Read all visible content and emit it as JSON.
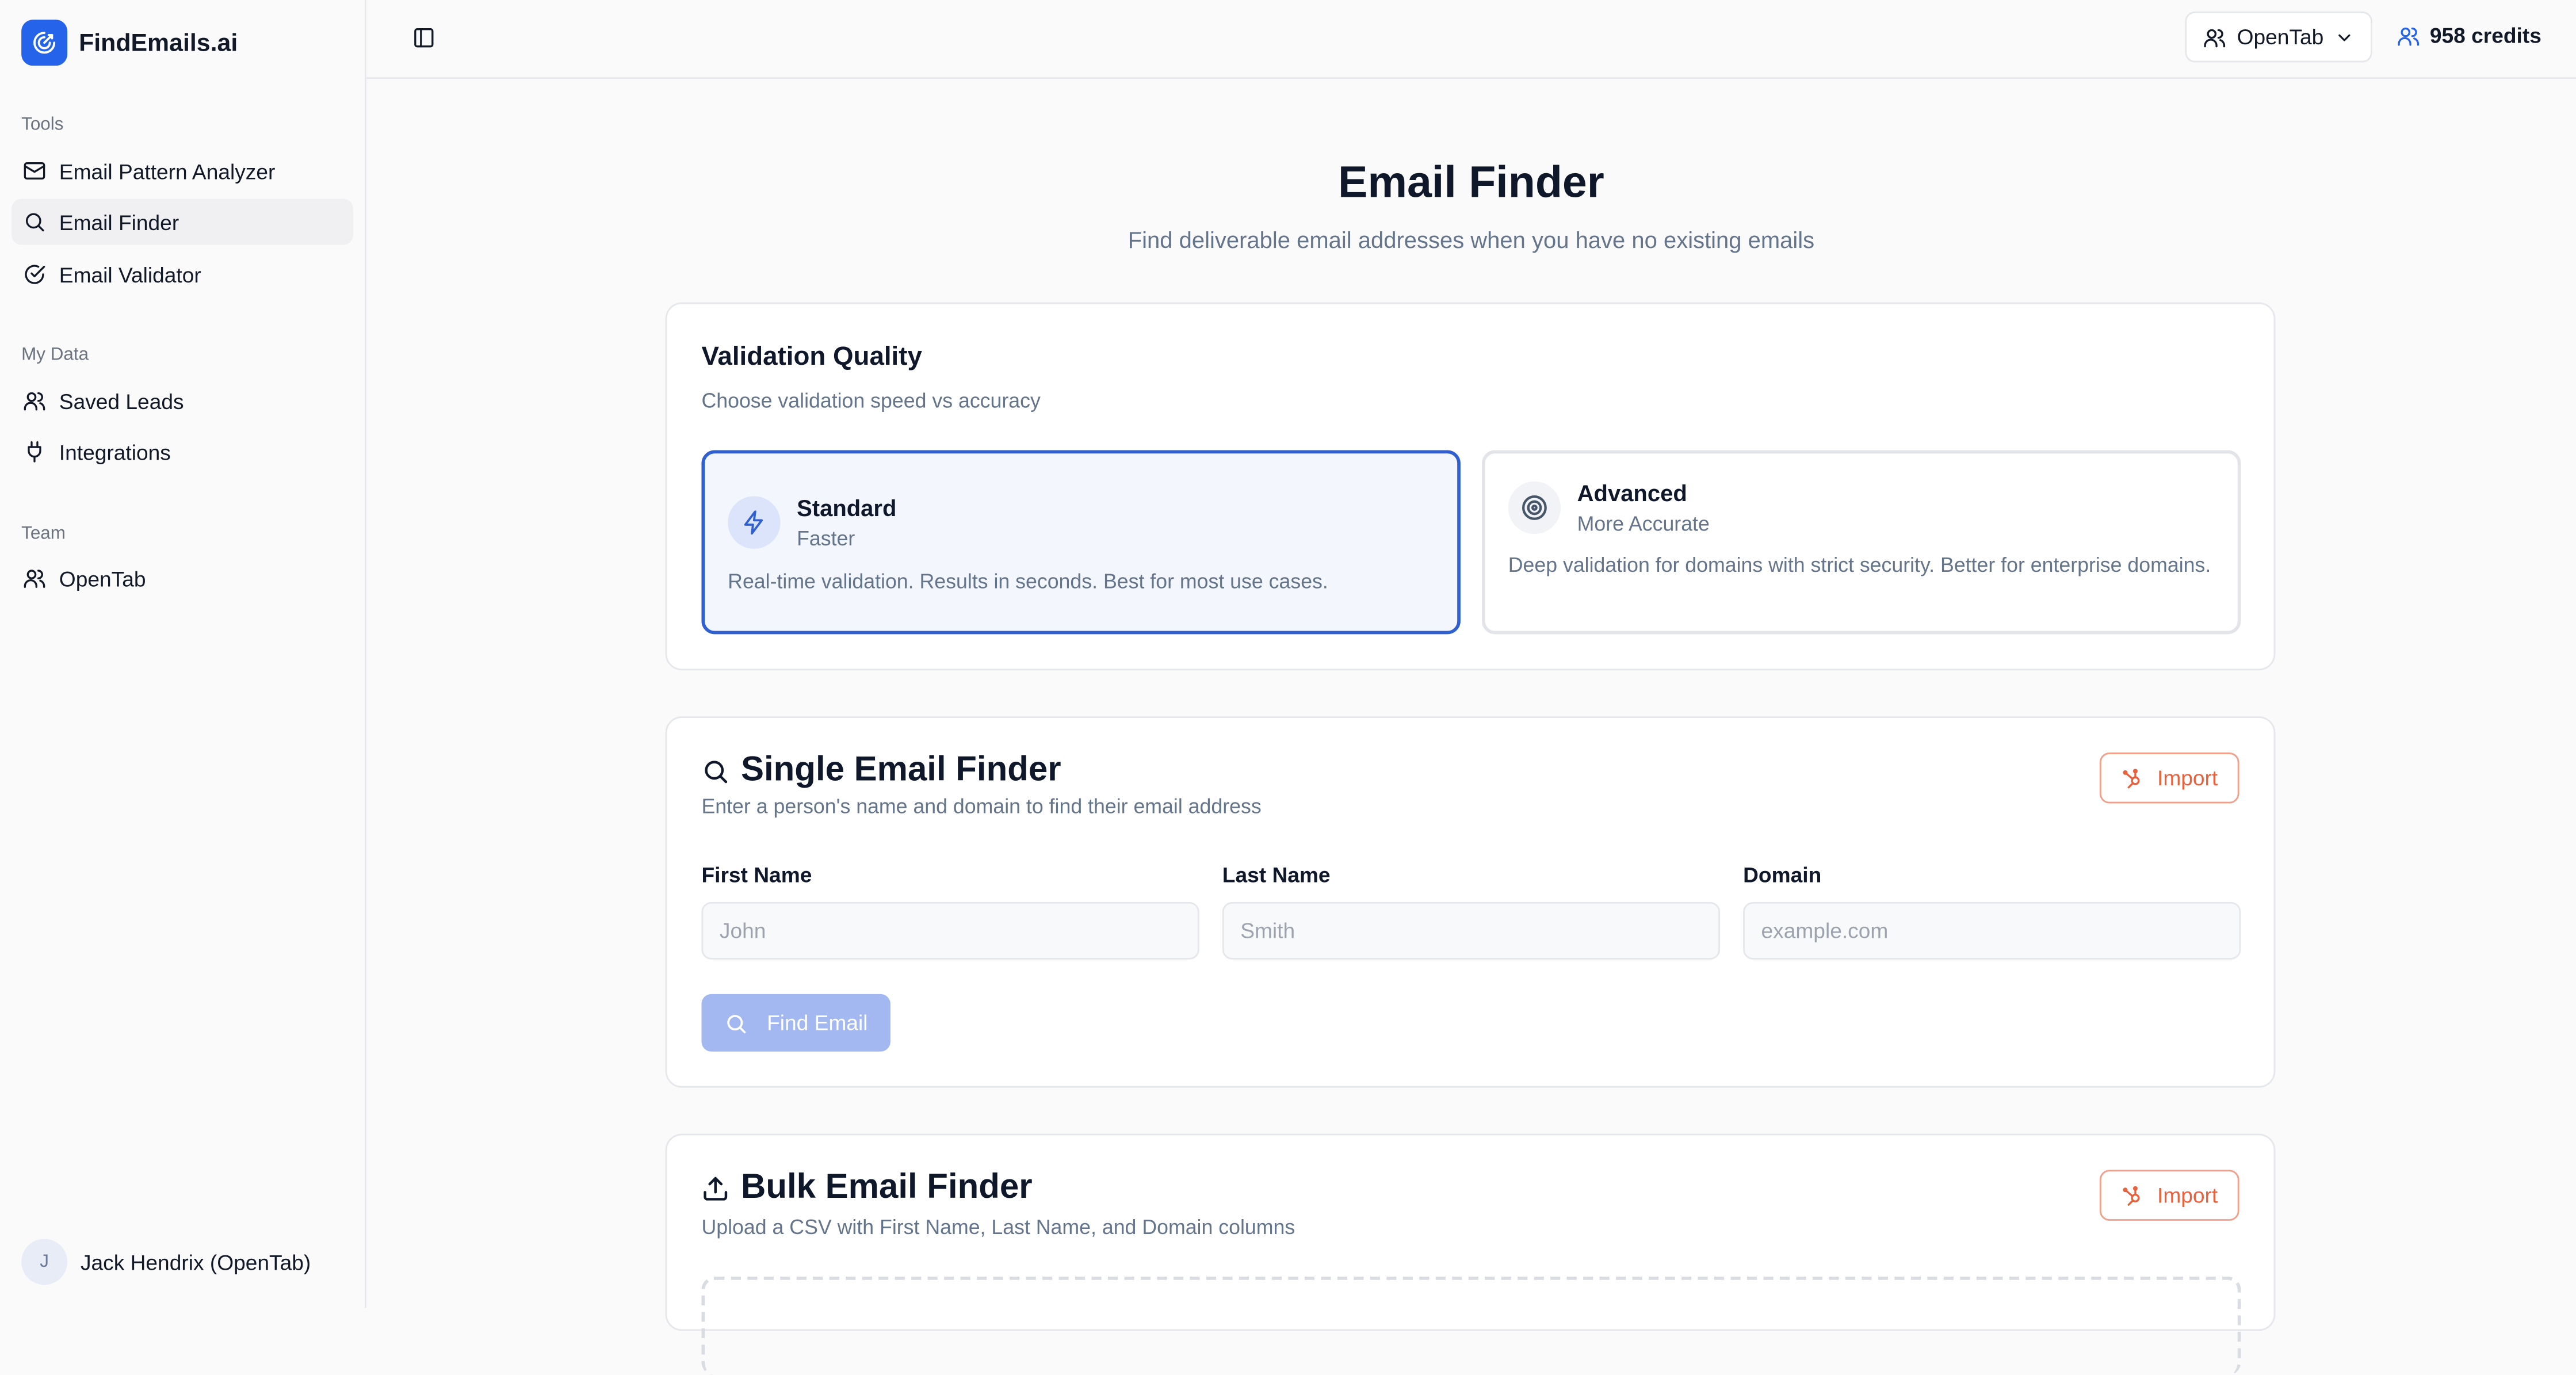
{
  "brand": {
    "name": "FindEmails.ai"
  },
  "sidebar": {
    "sections": [
      {
        "label": "Tools",
        "items": [
          "Email Pattern Analyzer",
          "Email Finder",
          "Email Validator"
        ]
      },
      {
        "label": "My Data",
        "items": [
          "Saved Leads",
          "Integrations"
        ]
      },
      {
        "label": "Team",
        "items": [
          "OpenTab"
        ]
      }
    ],
    "active_item": "Email Finder",
    "user": {
      "initial": "J",
      "name": "Jack Hendrix (OpenTab)"
    }
  },
  "topbar": {
    "team": "OpenTab",
    "credits": "958 credits"
  },
  "page": {
    "title": "Email Finder",
    "subtitle": "Find deliverable email addresses when you have no existing emails"
  },
  "validation": {
    "title": "Validation Quality",
    "description": "Choose validation speed vs accuracy",
    "options": [
      {
        "name": "Standard",
        "sub": "Faster",
        "description": "Real-time validation. Results in seconds. Best for most use cases.",
        "icon": "lightning-icon",
        "selected": true
      },
      {
        "name": "Advanced",
        "sub": "More Accurate",
        "description": "Deep validation for domains with strict security. Better for enterprise domains.",
        "icon": "target-icon",
        "selected": false
      }
    ]
  },
  "single": {
    "title": "Single Email Finder",
    "description": "Enter a person's name and domain to find their email address",
    "import_label": "Import",
    "fields": [
      {
        "label": "First Name",
        "placeholder": "John",
        "value": ""
      },
      {
        "label": "Last Name",
        "placeholder": "Smith",
        "value": ""
      },
      {
        "label": "Domain",
        "placeholder": "example.com",
        "value": ""
      }
    ],
    "button_label": "Find Email"
  },
  "bulk": {
    "title": "Bulk Email Finder",
    "description": "Upload a CSV with First Name, Last Name, and Domain columns",
    "import_label": "Import"
  },
  "colors": {
    "brand": "#2563eb",
    "selected_border": "#2f5fd0",
    "import_accent": "#e8603c",
    "button_disabled": "#a3b8f0"
  }
}
